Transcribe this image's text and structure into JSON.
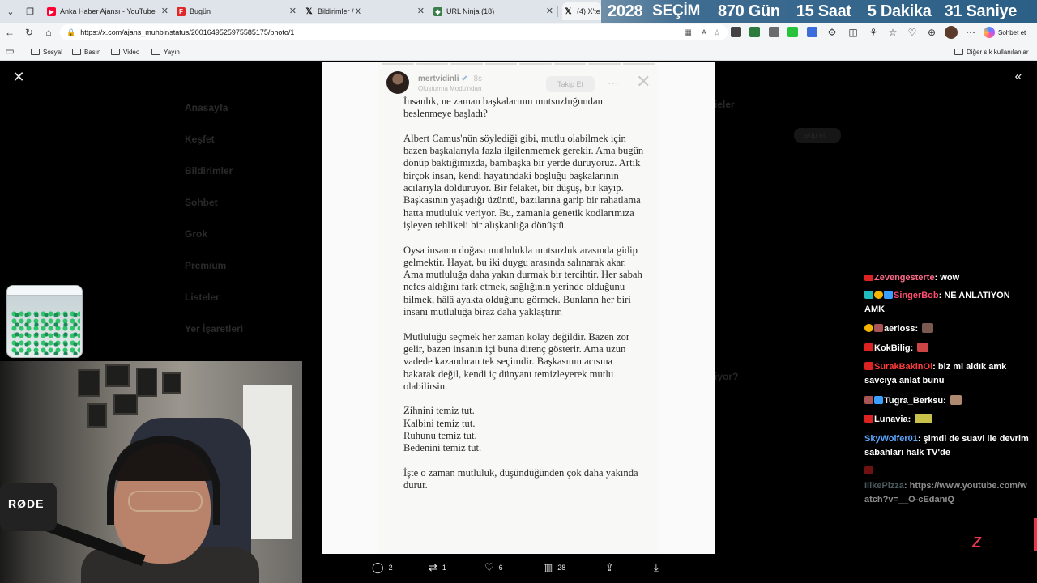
{
  "tabs": [
    {
      "title": "Anka Haber Ajansı - YouTube",
      "favicon": "youtube-icon",
      "color": "#ff0033"
    },
    {
      "title": "Bugün",
      "favicon": "flipboard-icon",
      "color": "#e12828"
    },
    {
      "title": "Bildirimler / X",
      "favicon": "x-icon",
      "color": "#000000"
    },
    {
      "title": "URL Ninja (18)",
      "favicon": "url-ninja-icon",
      "color": "#3b7d4d"
    },
    {
      "title": "(4) X'te",
      "favicon": "x-icon",
      "color": "#000000"
    }
  ],
  "countdown": {
    "year": "2028",
    "label": "SEÇİM",
    "days": "870 Gün",
    "hours": "15 Saat",
    "minutes": "5 Dakika",
    "seconds": "31 Saniye"
  },
  "address_bar": {
    "url": "https://x.com/ajans_muhbir/status/2001649525975585175/photo/1"
  },
  "sohbet_label": "Sohbet et",
  "bookmarks": [
    {
      "label": "Sosyal"
    },
    {
      "label": "Basın"
    },
    {
      "label": "Video"
    },
    {
      "label": "Yayın"
    }
  ],
  "other_bookmarks": "Diğer sık kullanılanlar",
  "x_sidebar_dim": [
    "Anasayfa",
    "Keşfet",
    "Bildirimler",
    "Sohbet",
    "Grok",
    "Premium",
    "Listeler",
    "Yer İşaretleri"
  ],
  "story": {
    "username": "mertvidinli",
    "time": "8s",
    "mode": "Oluşturma Modu'ndan",
    "follow_label": "Takip Et",
    "paragraphs": [
      "İnsanlık, ne zaman başkalarının mutsuzluğundan beslenmeye başladı?",
      "Albert Camus'nün söylediği gibi, mutlu olabilmek için bazen başkalarıyla fazla ilgilenmemek gerekir. Ama bugün dönüp baktığımızda, bambaşka bir yerde duruyoruz. Artık birçok insan, kendi hayatındaki boşluğu başkalarının acılarıyla dolduruyor. Bir felaket, bir düşüş, bir kayıp. Başkasının yaşadığı üzüntü, bazılarına garip bir rahatlama hatta mutluluk veriyor. Bu, zamanla genetik kodlarımıza işleyen tehlikeli bir alışkanlığa dönüştü.",
      "Oysa insanın doğası mutlulukla mutsuzluk arasında gidip gelmektir. Hayat, bu iki duygu arasında salınarak akar. Ama mutluluğa daha yakın durmak bir tercihtir. Her sabah nefes aldığını fark etmek, sağlığının yerinde olduğunu bilmek, hâlâ ayakta olduğunu görmek. Bunların her biri insanı mutluluğa biraz daha yaklaştırır.",
      "Mutluluğu seçmek her zaman kolay değildir. Bazen zor gelir, bazen insanın içi buna direnç gösterir. Ama uzun vadede kazandıran tek seçimdir. Başkasının acısına bakarak değil, kendi iç dünyanı temizleyerek mutlu olabilirsin.",
      "Zihnini temiz tut.\nKalbini temiz tut.\nRuhunu temiz tut.\nBedenini temiz tut.",
      "İşte o zaman mutluluk, düşündüğünden çok daha yakında durur."
    ]
  },
  "actions": {
    "replies": "2",
    "reposts": "1",
    "likes": "6",
    "views": "28"
  },
  "right_panel_dim": {
    "heading": "ieler",
    "follow": "akip et",
    "who": "iyor?"
  },
  "webcam": {
    "mic_brand": "RØDE"
  },
  "chat": [
    {
      "user": "Zevengesterte",
      "user_color": "#ff6b8a",
      "text": "wow"
    },
    {
      "user": "SingerBob",
      "user_color": "#ff4d6d",
      "text": "NE ANLATIYON AMK"
    },
    {
      "user": "aerloss",
      "user_color": "#ffffff",
      "text": ""
    },
    {
      "user": "KokBilig",
      "user_color": "#ffffff",
      "text": ""
    },
    {
      "user": "SurakBakinOl",
      "user_color": "#ff3b3b",
      "text": "biz mi aldık amk savcıya anlat bunu"
    },
    {
      "user": "Tugra_Berksu",
      "user_color": "#ffffff",
      "text": ""
    },
    {
      "user": "Lunavia",
      "user_color": "#ffffff",
      "text": ""
    },
    {
      "user": "SkyWolfer01",
      "user_color": "#5aa7ff",
      "text": "şimdi de suavi ile devrim sabahları halk TV'de"
    },
    {
      "user": "IlikePizza",
      "user_color": "#8aa2a8",
      "text": "https://www.youtube.com/watch?v=__O-cEdaniQ"
    }
  ]
}
